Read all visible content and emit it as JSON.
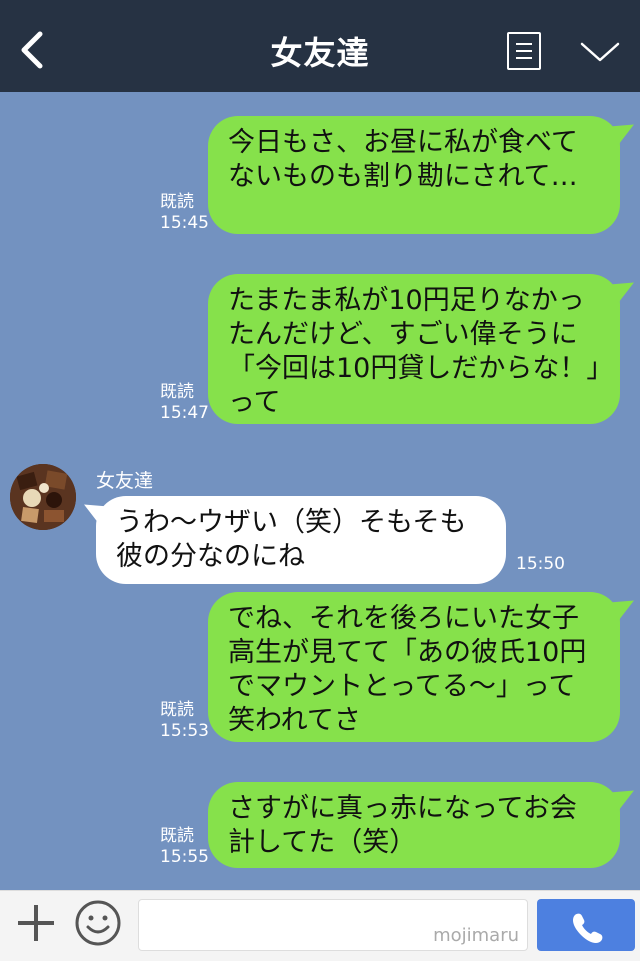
{
  "header": {
    "title": "女友達"
  },
  "messages": [
    {
      "from": "me",
      "text": "今日もさ、お昼に私が食べてないものも割り勘にされて…",
      "read": "既読",
      "time": "15:45"
    },
    {
      "from": "me",
      "text": "たまたま私が10円足りなかったんだけど、すごい偉そうに「今回は10円貸しだからな！」って",
      "read": "既読",
      "time": "15:47"
    },
    {
      "from": "them",
      "sender": "女友達",
      "text": "うわ〜ウザい（笑）そもそも彼の分なのにね",
      "time": "15:50"
    },
    {
      "from": "me",
      "text": "でね、それを後ろにいた女子高生が見てて「あの彼氏10円でマウントとってる〜」って笑われてさ",
      "read": "既読",
      "time": "15:53"
    },
    {
      "from": "me",
      "text": "さすがに真っ赤になってお会計してた（笑）",
      "read": "既読",
      "time": "15:55"
    }
  ],
  "footer": {
    "watermark": "mojimaru"
  },
  "icons": {
    "back": "back-arrow-icon",
    "menu": "note-menu-icon",
    "collapse": "chevron-down-icon",
    "add": "plus-icon",
    "emoji": "smiley-icon",
    "call": "phone-icon"
  },
  "colors": {
    "header_bg": "#263243",
    "chat_bg": "#7392c0",
    "my_bubble": "#86e14b",
    "their_bubble": "#ffffff",
    "call_button": "#4d80e0"
  }
}
